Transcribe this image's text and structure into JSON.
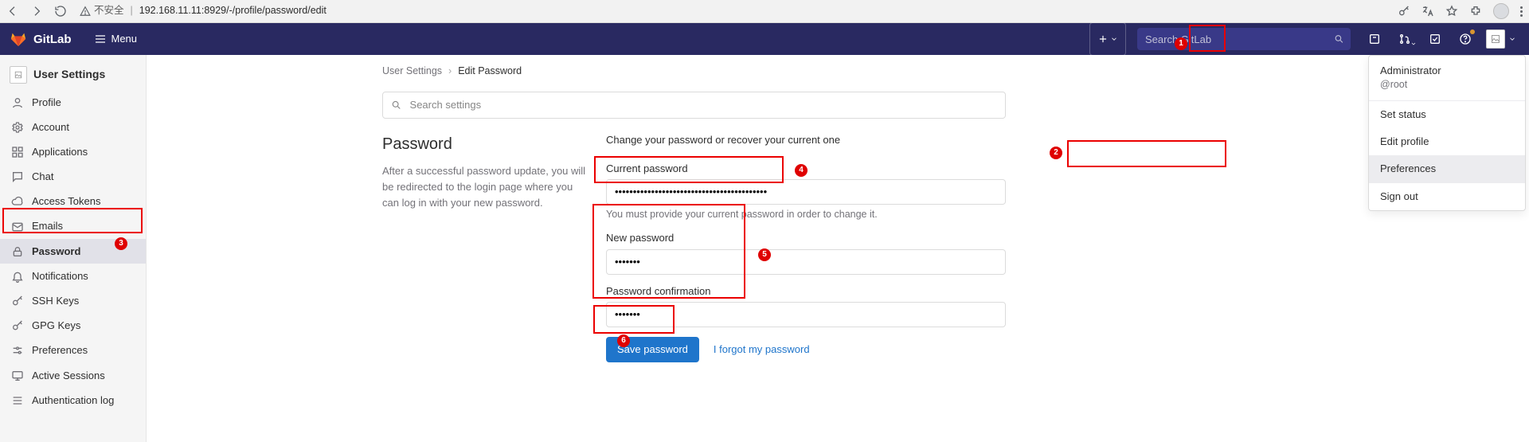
{
  "browser": {
    "insecure_label": "不安全",
    "url": "192.168.11.11:8929/-/profile/password/edit"
  },
  "header": {
    "brand": "GitLab",
    "menu_label": "Menu",
    "search_placeholder": "Search GitLab"
  },
  "sidebar": {
    "title": "User Settings",
    "items": [
      {
        "label": "Profile"
      },
      {
        "label": "Account"
      },
      {
        "label": "Applications"
      },
      {
        "label": "Chat"
      },
      {
        "label": "Access Tokens"
      },
      {
        "label": "Emails"
      },
      {
        "label": "Password"
      },
      {
        "label": "Notifications"
      },
      {
        "label": "SSH Keys"
      },
      {
        "label": "GPG Keys"
      },
      {
        "label": "Preferences"
      },
      {
        "label": "Active Sessions"
      },
      {
        "label": "Authentication log"
      }
    ]
  },
  "breadcrumb": {
    "root": "User Settings",
    "current": "Edit Password"
  },
  "settings_search": {
    "placeholder": "Search settings"
  },
  "password": {
    "heading": "Password",
    "intro": "After a successful password update, you will be redirected to the login page where you can log in with your new password.",
    "lead": "Change your password or recover your current one",
    "current_label": "Current password",
    "current_value": "••••••••••••••••••••••••••••••••••••••••••",
    "current_hint": "You must provide your current password in order to change it.",
    "new_label": "New password",
    "new_value": "•••••••",
    "confirm_label": "Password confirmation",
    "confirm_value": "•••••••",
    "save_label": "Save password",
    "forgot_label": "I forgot my password"
  },
  "user_menu": {
    "name": "Administrator",
    "handle": "@root",
    "set_status": "Set status",
    "edit_profile": "Edit profile",
    "preferences": "Preferences",
    "sign_out": "Sign out",
    "avatar_alt": "Admin"
  },
  "annotations": {
    "n1": "1",
    "n2": "2",
    "n3": "3",
    "n4": "4",
    "n5": "5",
    "n6": "6"
  }
}
